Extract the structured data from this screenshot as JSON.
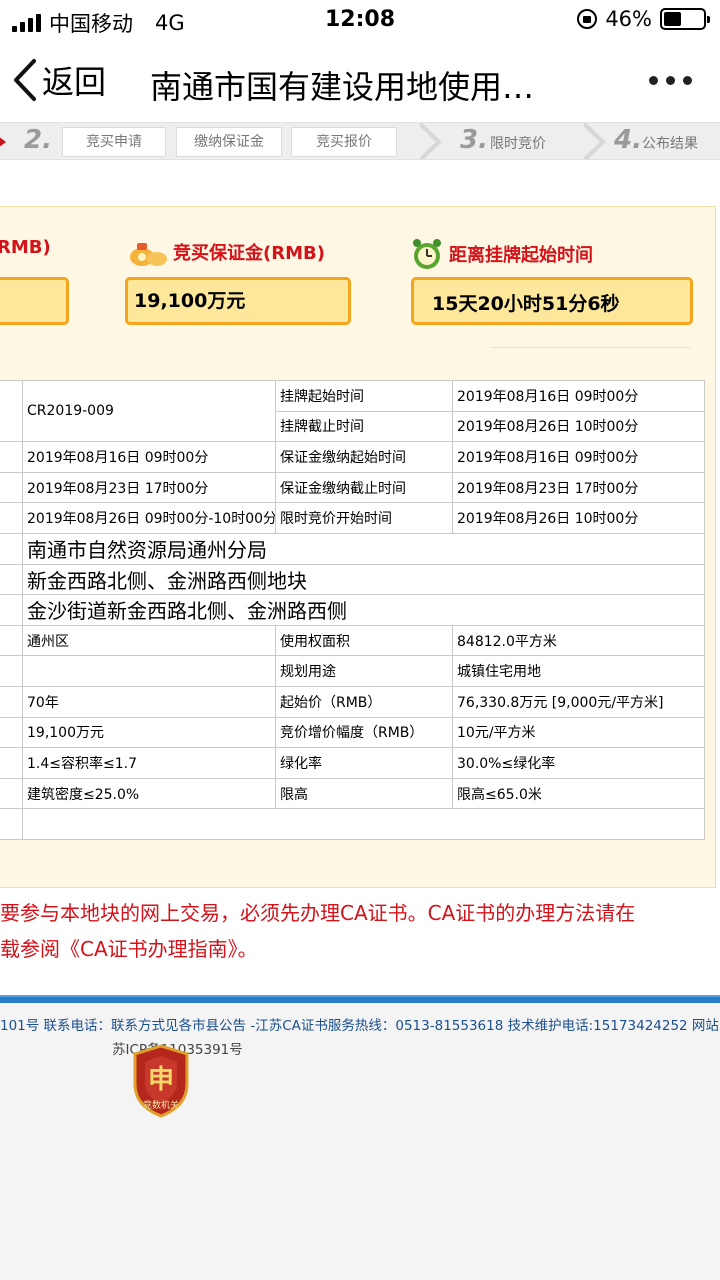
{
  "status_bar": {
    "carrier": "中国移动",
    "network": "4G",
    "time": "12:08",
    "battery": "46%",
    "battery_level": 0.46
  },
  "nav": {
    "back_label": "返回",
    "title": "南通市国有建设用地使用…"
  },
  "steps": {
    "step2_num": "2.",
    "sub1": "竞买申请",
    "sub2": "缴纳保证金",
    "sub3": "竞买报价",
    "step3_num": "3.",
    "step3_label": "限时竞价",
    "step4_num": "4.",
    "step4_label": "公布结果"
  },
  "summary": {
    "col1_label": "RMB)",
    "col2_label": "竞买保证金(RMB)",
    "col2_value": "19,100万元",
    "col3_label": "距离挂牌起始时间",
    "col3_value": "15天20小时51分6秒"
  },
  "table": {
    "code": "CR2019-009",
    "r1_label": "挂牌起始时间",
    "r1_value": "2019年08月16日 09时00分",
    "r2_label": "挂牌截止时间",
    "r2_value": "2019年08月26日 10时00分",
    "r3_left": "2019年08月16日 09时00分",
    "r3_label": "保证金缴纳起始时间",
    "r3_value": "2019年08月16日 09时00分",
    "r4_left": "2019年08月23日 17时00分",
    "r4_label": "保证金缴纳截止时间",
    "r4_value": "2019年08月23日 17时00分",
    "r5_left": "2019年08月26日 09时00分-10时00分",
    "r5_label": "限时竞价开始时间",
    "r5_value": "2019年08月26日 10时00分",
    "org": "南通市自然资源局通州分局",
    "parcel": "新金西路北侧、金洲路西侧地块",
    "location": "金沙街道新金西路北侧、金洲路西侧",
    "r9_left": "通州区",
    "r9_label": "使用权面积",
    "r9_value": "84812.0平方米",
    "r10_label": "规划用途",
    "r10_value": "城镇住宅用地",
    "r11_left": "70年",
    "r11_label": "起始价（RMB）",
    "r11_value": "76,330.8万元 [9,000元/平方米]",
    "r12_left": "19,100万元",
    "r12_label": "竞价增价幅度（RMB）",
    "r12_value": "10元/平方米",
    "r13_left": "1.4≤容积率≤1.7",
    "r13_label": "绿化率",
    "r13_value": "30.0%≤绿化率",
    "r14_left": "建筑密度≤25.0%",
    "r14_label": "限高",
    "r14_value": "限高≤65.0米"
  },
  "notice": {
    "line1": "要参与本地块的网上交易，必须先办理CA证书。CA证书的办理方法请在",
    "line2": "载参阅《CA证书办理指南》。"
  },
  "footer": {
    "line1": "101号 联系电话：联系方式见各市县公告 -江苏CA证书服务热线：0513-81553618 技术维护电话:15173424252 网站",
    "line2": "苏ICP备11035391号",
    "badge_text": "竞数机关"
  }
}
